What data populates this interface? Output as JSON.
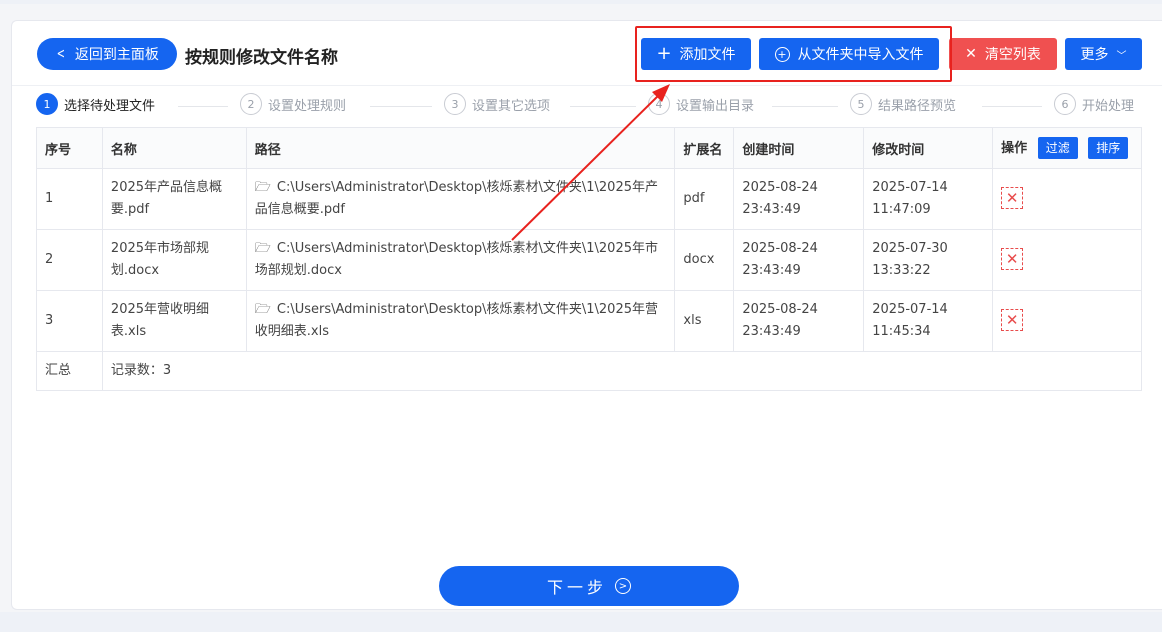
{
  "header": {
    "back_label": "返回到主面板",
    "title": "按规则修改文件名称",
    "add_file_label": "添加文件",
    "import_folder_label": "从文件夹中导入文件",
    "clear_label": "清空列表",
    "more_label": "更多"
  },
  "steps": [
    {
      "num": "1",
      "label": "选择待处理文件"
    },
    {
      "num": "2",
      "label": "设置处理规则"
    },
    {
      "num": "3",
      "label": "设置其它选项"
    },
    {
      "num": "4",
      "label": "设置输出目录"
    },
    {
      "num": "5",
      "label": "结果路径预览"
    },
    {
      "num": "6",
      "label": "开始处理"
    }
  ],
  "table": {
    "columns": [
      "序号",
      "名称",
      "路径",
      "扩展名",
      "创建时间",
      "修改时间",
      "操作"
    ],
    "filter_label": "过滤",
    "sort_label": "排序",
    "rows": [
      {
        "index": "1",
        "name": "2025年产品信息概要.pdf",
        "path": "C:\\Users\\Administrator\\Desktop\\核烁素材\\文件夹\\1\\2025年产品信息概要.pdf",
        "ext": "pdf",
        "created": "2025-08-24 23:43:49",
        "modified": "2025-07-14 11:47:09"
      },
      {
        "index": "2",
        "name": "2025年市场部规划.docx",
        "path": "C:\\Users\\Administrator\\Desktop\\核烁素材\\文件夹\\1\\2025年市场部规划.docx",
        "ext": "docx",
        "created": "2025-08-24 23:43:49",
        "modified": "2025-07-30 13:33:22"
      },
      {
        "index": "3",
        "name": "2025年营收明细表.xls",
        "path": "C:\\Users\\Administrator\\Desktop\\核烁素材\\文件夹\\1\\2025年营收明细表.xls",
        "ext": "xls",
        "created": "2025-08-24 23:43:49",
        "modified": "2025-07-14 11:45:34"
      }
    ],
    "summary_label": "汇总",
    "record_count": "记录数：3"
  },
  "footer": {
    "next_label": "下一步"
  },
  "colors": {
    "accent": "#1565f0",
    "danger": "#f05050",
    "annotation": "#e8221e"
  },
  "icons": {
    "back": "chevron-left-icon",
    "add": "plus-icon",
    "import": "plus-circle-icon",
    "clear": "close-icon",
    "more": "chevron-down-icon",
    "folder": "folder-icon",
    "delete": "delete-icon",
    "next": "chevron-right-circle-icon"
  }
}
